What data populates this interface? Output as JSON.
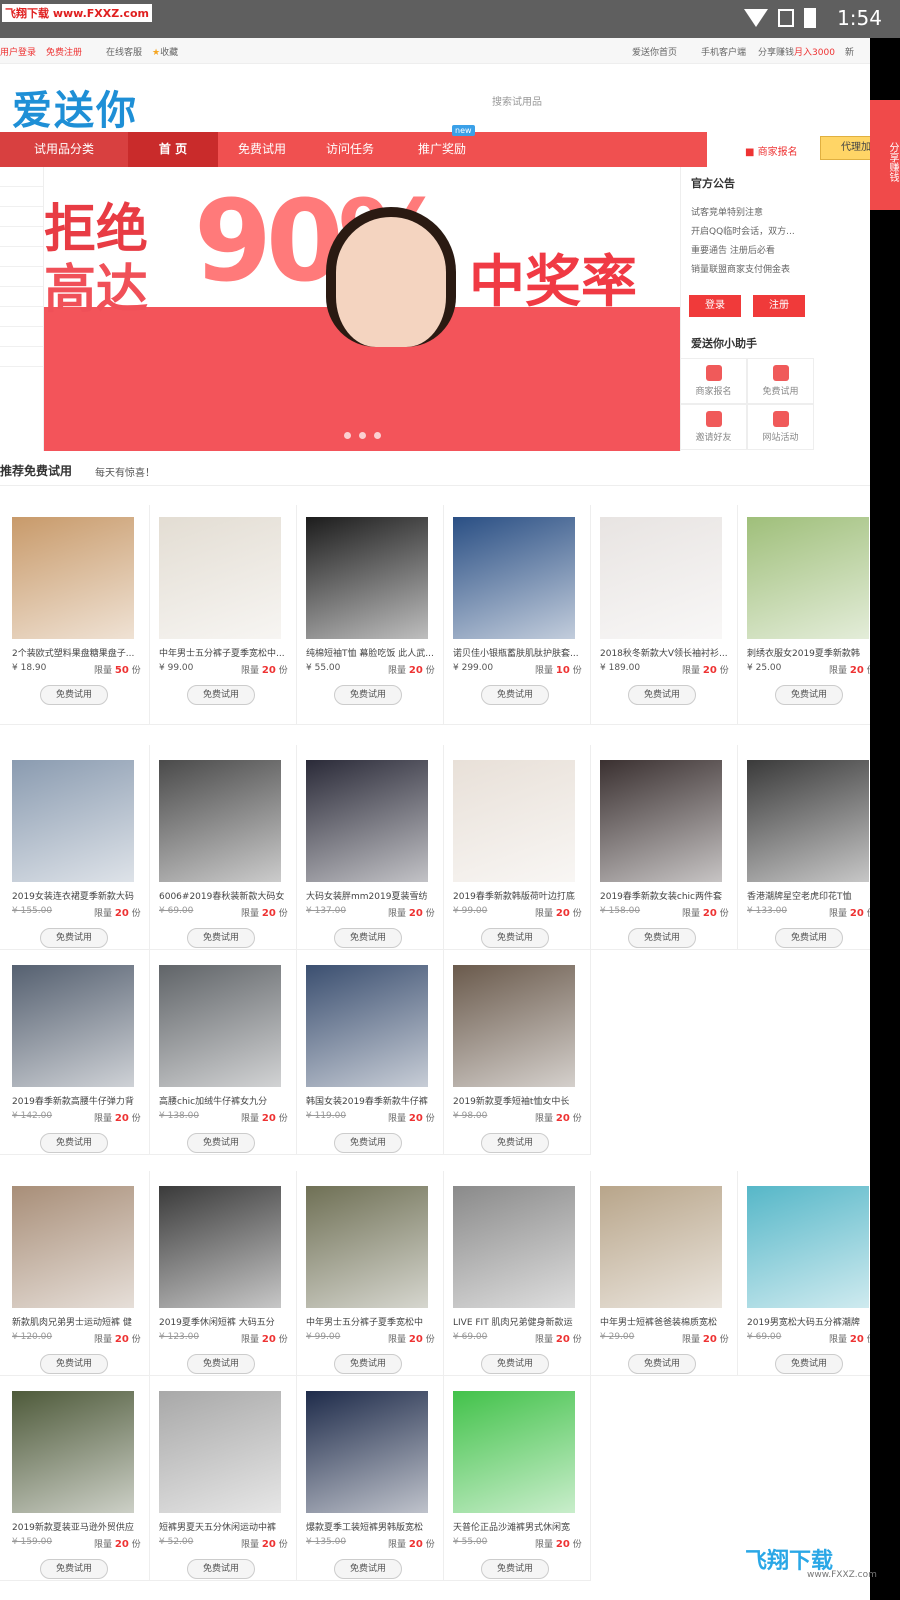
{
  "status_bar": {
    "watermark": "飞翔下载 www.FXXZ.com",
    "time": "1:54"
  },
  "top_bar": {
    "login": "用户登录",
    "register": "免费注册",
    "service": "在线客服",
    "favorite": "收藏",
    "home": "爱送你首页",
    "mobile": "手机客户端",
    "share_prefix": "分享赚钱",
    "share_amount": "月入3000",
    "more": "新"
  },
  "logo": "爱送你",
  "search_placeholder": "搜索试用品",
  "nav": {
    "category": "试用品分类",
    "items": [
      "首 页",
      "免费试用",
      "访问任务",
      "推广奖励"
    ],
    "badge": "new",
    "merchant": "商家报名",
    "agent": "代理加"
  },
  "banner": {
    "line1": "拒绝",
    "line2": "高达",
    "big": "90%",
    "right": "中奖率"
  },
  "notice": {
    "title": "官方公告",
    "items": [
      "试客竞单特别注意",
      "开启QQ临时会话，双方...",
      "重要通告 注册后必看",
      "销量联盟商家支付佣金表"
    ],
    "login": "登录",
    "register": "注册"
  },
  "helper": {
    "title": "爱送你小助手",
    "items": [
      "商家报名",
      "免费试用",
      "邀请好友",
      "网站活动"
    ]
  },
  "share_tab": "分享赚钱",
  "section": {
    "title": "推荐免费试用",
    "subtitle": "每天有惊喜！"
  },
  "try_label": "免费试用",
  "limit_prefix": "限量",
  "limit_suffix": "份",
  "rows": [
    [
      {
        "title": "2个装欧式塑料果盘糖果盘子...",
        "price": "¥ 18.90",
        "limit": "50"
      },
      {
        "title": "中年男士五分裤子夏季宽松中...",
        "price": "¥ 99.00",
        "limit": "20"
      },
      {
        "title": "纯棉短袖T恤 幕脸吃饭 此人武...",
        "price": "¥ 55.00",
        "limit": "20"
      },
      {
        "title": "诺贝佳小银瓶蓄肤肌肽护肤套...",
        "price": "¥ 299.00",
        "limit": "10"
      },
      {
        "title": "2018秋冬新款大V领长袖衬衫...",
        "price": "¥ 189.00",
        "limit": "20"
      },
      {
        "title": "刺绣衣服女2019夏季新款韩",
        "price": "¥ 25.00",
        "limit": "20"
      }
    ],
    [
      {
        "title": "2019女装连衣裙夏季新款大码",
        "price": "¥ 155.00",
        "limit": "20"
      },
      {
        "title": "6006#2019春秋装新款大码女",
        "price": "¥ 69.00",
        "limit": "20"
      },
      {
        "title": "大码女装胖mm2019夏装雪纺",
        "price": "¥ 137.00",
        "limit": "20"
      },
      {
        "title": "2019春季新款韩版荷叶边打底",
        "price": "¥ 99.00",
        "limit": "20"
      },
      {
        "title": "2019春季新款女装chic两件套",
        "price": "¥ 158.00",
        "limit": "20"
      },
      {
        "title": "香港潮牌星空老虎印花T恤",
        "price": "¥ 133.00",
        "limit": "20"
      }
    ],
    [
      {
        "title": "2019春季新款高腰牛仔弹力背",
        "price": "¥ 142.00",
        "limit": "20"
      },
      {
        "title": "高腰chic加绒牛仔裤女九分",
        "price": "¥ 138.00",
        "limit": "20"
      },
      {
        "title": "韩国女装2019春季新款牛仔裤",
        "price": "¥ 119.00",
        "limit": "20"
      },
      {
        "title": "2019新款夏季短袖t恤女中长",
        "price": "¥ 98.00",
        "limit": "20"
      }
    ],
    [
      {
        "title": "新款肌肉兄弟男士运动短裤 健",
        "price": "¥ 120.00",
        "limit": "20"
      },
      {
        "title": "2019夏季休闲短裤 大码五分",
        "price": "¥ 123.00",
        "limit": "20"
      },
      {
        "title": "中年男士五分裤子夏季宽松中",
        "price": "¥ 99.00",
        "limit": "20"
      },
      {
        "title": "LIVE FIT 肌肉兄弟健身新款运",
        "price": "¥ 69.00",
        "limit": "20"
      },
      {
        "title": "中年男士短裤爸爸装棉质宽松",
        "price": "¥ 29.00",
        "limit": "20"
      },
      {
        "title": "2019男宽松大码五分裤潮牌",
        "price": "¥ 69.00",
        "limit": "20"
      }
    ],
    [
      {
        "title": "2019新款夏装亚马逊外贸供应",
        "price": "¥ 159.00",
        "limit": "20"
      },
      {
        "title": "短裤男夏天五分休闲运动中裤",
        "price": "¥ 52.00",
        "limit": "20"
      },
      {
        "title": "爆款夏季工装短裤男韩版宽松",
        "price": "¥ 135.00",
        "limit": "20"
      },
      {
        "title": "天普伦正品沙滩裤男式休闲宽",
        "price": "¥ 55.00",
        "limit": "20"
      }
    ]
  ],
  "colors": {
    "brand_red": "#f05050",
    "brand_blue": "#1e8fd6",
    "thumbs": [
      [
        "#c89a6a",
        "#e3ddd3",
        "#1c1c1c",
        "#2a4f84",
        "#e8e4e2",
        "#9fbf7a"
      ],
      [
        "#8a9bb0",
        "#4a4a4a",
        "#2a2a38",
        "#e8e0d8",
        "#3a3030",
        "#3a3a3a"
      ],
      [
        "#556070",
        "#606468",
        "#3b4f70",
        "#6a5a4c"
      ],
      [
        "#a88e78",
        "#3a3a3a",
        "#6f7055",
        "#8a8a8a",
        "#b8a58a",
        "#56b7c8"
      ],
      [
        "#4e5a3a",
        "#a8a8a8",
        "#1e2b4a",
        "#42c24a"
      ]
    ]
  },
  "bottom_watermark": {
    "logo": "飞翔下载",
    "url": "www.FXXZ.com"
  }
}
